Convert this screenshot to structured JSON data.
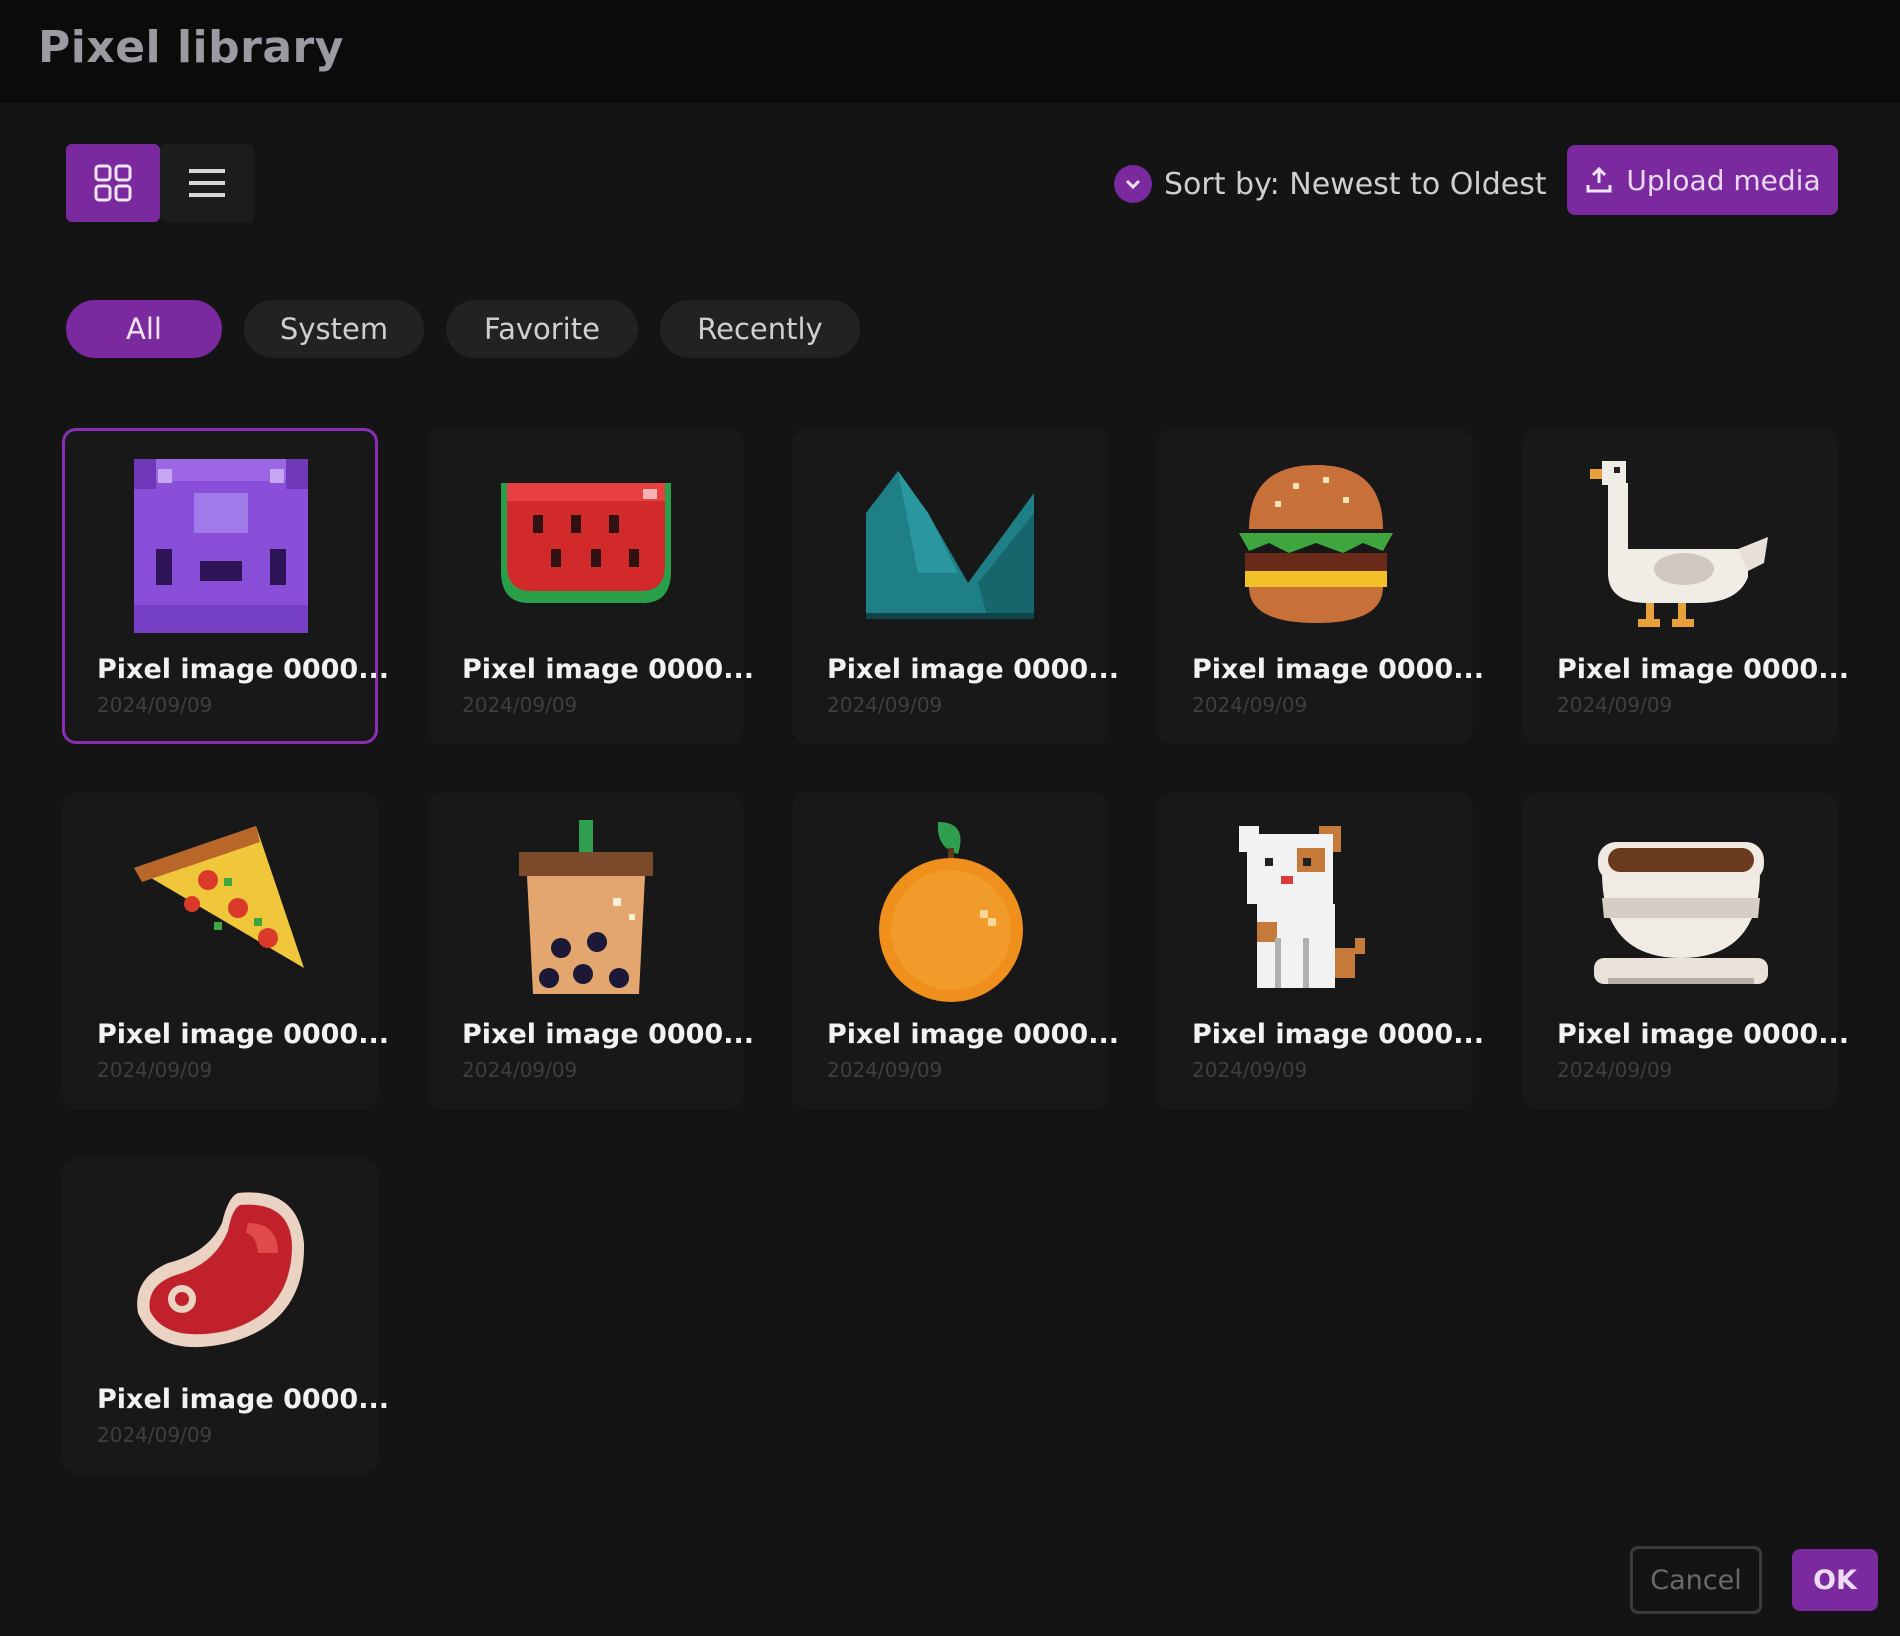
{
  "window": {
    "title": "Pixel library"
  },
  "toolbar": {
    "view_modes": [
      {
        "name": "grid",
        "icon": "grid-icon",
        "active": true
      },
      {
        "name": "list",
        "icon": "list-icon",
        "active": false
      }
    ],
    "sort_label": "Sort by: Newest to Oldest",
    "sort_icon": "chevron-down-icon",
    "upload_label": "Upload media",
    "upload_icon": "upload-icon"
  },
  "filters": [
    {
      "label": "All",
      "active": true
    },
    {
      "label": "System",
      "active": false
    },
    {
      "label": "Favorite",
      "active": false
    },
    {
      "label": "Recently",
      "active": false
    }
  ],
  "items": [
    {
      "title": "Pixel image 0000...",
      "date": "2024/09/09",
      "image": "purple-creature",
      "selected": true
    },
    {
      "title": "Pixel image 0000...",
      "date": "2024/09/09",
      "image": "watermelon",
      "selected": false
    },
    {
      "title": "Pixel image 0000...",
      "date": "2024/09/09",
      "image": "teal-mountain",
      "selected": false
    },
    {
      "title": "Pixel image 0000...",
      "date": "2024/09/09",
      "image": "burger",
      "selected": false
    },
    {
      "title": "Pixel image 0000...",
      "date": "2024/09/09",
      "image": "goose",
      "selected": false
    },
    {
      "title": "Pixel image 0000...",
      "date": "2024/09/09",
      "image": "pizza-slice",
      "selected": false
    },
    {
      "title": "Pixel image 0000...",
      "date": "2024/09/09",
      "image": "bubble-tea",
      "selected": false
    },
    {
      "title": "Pixel image 0000...",
      "date": "2024/09/09",
      "image": "orange",
      "selected": false
    },
    {
      "title": "Pixel image 0000...",
      "date": "2024/09/09",
      "image": "dog",
      "selected": false
    },
    {
      "title": "Pixel image 0000...",
      "date": "2024/09/09",
      "image": "coffee-cup",
      "selected": false
    },
    {
      "title": "Pixel image 0000...",
      "date": "2024/09/09",
      "image": "steak",
      "selected": false
    }
  ],
  "footer": {
    "cancel_label": "Cancel",
    "ok_label": "OK"
  },
  "colors": {
    "accent": "#7a2a9e",
    "background": "#141414",
    "titlebar": "#0b0b0c"
  }
}
